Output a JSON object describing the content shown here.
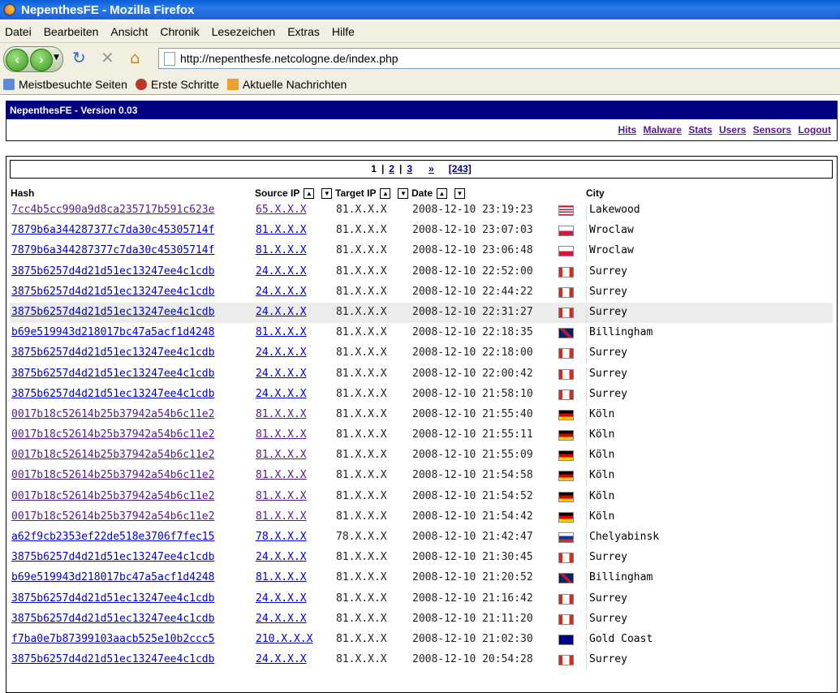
{
  "window": {
    "title": "NepenthesFE - Mozilla Firefox"
  },
  "menu": [
    "Datei",
    "Bearbeiten",
    "Ansicht",
    "Chronik",
    "Lesezeichen",
    "Extras",
    "Hilfe"
  ],
  "address": {
    "url": "http://nepenthesfe.netcologne.de/index.php"
  },
  "bookmarks": [
    "Meistbesuchte Seiten",
    "Erste Schritte",
    "Aktuelle Nachrichten"
  ],
  "app": {
    "title": "NepenthesFE - Version 0.03",
    "nav": [
      "Hits",
      "Malware",
      "Stats",
      "Users",
      "Sensors",
      "Logout"
    ]
  },
  "pager": {
    "current": "1",
    "pages": [
      "2",
      "3"
    ],
    "next": "»",
    "total": "[243]"
  },
  "columns": {
    "hash": "Hash",
    "source_ip": "Source IP",
    "target_ip": "Target IP",
    "date": "Date",
    "city": "City"
  },
  "colors": {
    "flag_us": "#b22234",
    "flag_pl": "#dc143c",
    "flag_ca": "#d52b1e",
    "flag_gb": "#012169",
    "flag_de": "#000000",
    "flag_ru": "#0039a6",
    "flag_au": "#00008b"
  },
  "rows": [
    {
      "hash": "7cc4b5cc990a9d8ca235717b591c623e",
      "src": "65.X.X.X",
      "tgt": "81.X.X.X",
      "date": "2008-12-10 23:19:23",
      "flag": "us",
      "city": "Lakewood",
      "visited": true
    },
    {
      "hash": "7879b6a344287377c7da30c45305714f",
      "src": "81.X.X.X",
      "tgt": "81.X.X.X",
      "date": "2008-12-10 23:07:03",
      "flag": "pl",
      "city": "Wroclaw",
      "visited": false
    },
    {
      "hash": "7879b6a344287377c7da30c45305714f",
      "src": "81.X.X.X",
      "tgt": "81.X.X.X",
      "date": "2008-12-10 23:06:48",
      "flag": "pl",
      "city": "Wroclaw",
      "visited": false
    },
    {
      "hash": "3875b6257d4d21d51ec13247ee4c1cdb",
      "src": "24.X.X.X",
      "tgt": "81.X.X.X",
      "date": "2008-12-10 22:52:00",
      "flag": "ca",
      "city": "Surrey",
      "visited": false
    },
    {
      "hash": "3875b6257d4d21d51ec13247ee4c1cdb",
      "src": "24.X.X.X",
      "tgt": "81.X.X.X",
      "date": "2008-12-10 22:44:22",
      "flag": "ca",
      "city": "Surrey",
      "visited": false
    },
    {
      "hash": "3875b6257d4d21d51ec13247ee4c1cdb",
      "src": "24.X.X.X",
      "tgt": "81.X.X.X",
      "date": "2008-12-10 22:31:27",
      "flag": "ca",
      "city": "Surrey",
      "visited": false,
      "highlight": true
    },
    {
      "hash": "b69e519943d218017bc47a5acf1d4248",
      "src": "81.X.X.X",
      "tgt": "81.X.X.X",
      "date": "2008-12-10 22:18:35",
      "flag": "gb",
      "city": "Billingham",
      "visited": false
    },
    {
      "hash": "3875b6257d4d21d51ec13247ee4c1cdb",
      "src": "24.X.X.X",
      "tgt": "81.X.X.X",
      "date": "2008-12-10 22:18:00",
      "flag": "ca",
      "city": "Surrey",
      "visited": false
    },
    {
      "hash": "3875b6257d4d21d51ec13247ee4c1cdb",
      "src": "24.X.X.X",
      "tgt": "81.X.X.X",
      "date": "2008-12-10 22:00:42",
      "flag": "ca",
      "city": "Surrey",
      "visited": false
    },
    {
      "hash": "3875b6257d4d21d51ec13247ee4c1cdb",
      "src": "24.X.X.X",
      "tgt": "81.X.X.X",
      "date": "2008-12-10 21:58:10",
      "flag": "ca",
      "city": "Surrey",
      "visited": false
    },
    {
      "hash": "0017b18c52614b25b37942a54b6c11e2",
      "src": "81.X.X.X",
      "tgt": "81.X.X.X",
      "date": "2008-12-10 21:55:40",
      "flag": "de",
      "city": "Köln",
      "visited": true
    },
    {
      "hash": "0017b18c52614b25b37942a54b6c11e2",
      "src": "81.X.X.X",
      "tgt": "81.X.X.X",
      "date": "2008-12-10 21:55:11",
      "flag": "de",
      "city": "Köln",
      "visited": true
    },
    {
      "hash": "0017b18c52614b25b37942a54b6c11e2",
      "src": "81.X.X.X",
      "tgt": "81.X.X.X",
      "date": "2008-12-10 21:55:09",
      "flag": "de",
      "city": "Köln",
      "visited": true
    },
    {
      "hash": "0017b18c52614b25b37942a54b6c11e2",
      "src": "81.X.X.X",
      "tgt": "81.X.X.X",
      "date": "2008-12-10 21:54:58",
      "flag": "de",
      "city": "Köln",
      "visited": true
    },
    {
      "hash": "0017b18c52614b25b37942a54b6c11e2",
      "src": "81.X.X.X",
      "tgt": "81.X.X.X",
      "date": "2008-12-10 21:54:52",
      "flag": "de",
      "city": "Köln",
      "visited": true
    },
    {
      "hash": "0017b18c52614b25b37942a54b6c11e2",
      "src": "81.X.X.X",
      "tgt": "81.X.X.X",
      "date": "2008-12-10 21:54:42",
      "flag": "de",
      "city": "Köln",
      "visited": true
    },
    {
      "hash": "a62f9cb2353ef22de518e3706f7fec15",
      "src": "78.X.X.X",
      "tgt": "78.X.X.X",
      "date": "2008-12-10 21:42:47",
      "flag": "ru",
      "city": "Chelyabinsk",
      "visited": false
    },
    {
      "hash": "3875b6257d4d21d51ec13247ee4c1cdb",
      "src": "24.X.X.X",
      "tgt": "81.X.X.X",
      "date": "2008-12-10 21:30:45",
      "flag": "ca",
      "city": "Surrey",
      "visited": false
    },
    {
      "hash": "b69e519943d218017bc47a5acf1d4248",
      "src": "81.X.X.X",
      "tgt": "81.X.X.X",
      "date": "2008-12-10 21:20:52",
      "flag": "gb",
      "city": "Billingham",
      "visited": false
    },
    {
      "hash": "3875b6257d4d21d51ec13247ee4c1cdb",
      "src": "24.X.X.X",
      "tgt": "81.X.X.X",
      "date": "2008-12-10 21:16:42",
      "flag": "ca",
      "city": "Surrey",
      "visited": false
    },
    {
      "hash": "3875b6257d4d21d51ec13247ee4c1cdb",
      "src": "24.X.X.X",
      "tgt": "81.X.X.X",
      "date": "2008-12-10 21:11:20",
      "flag": "ca",
      "city": "Surrey",
      "visited": false
    },
    {
      "hash": "f7ba0e7b87399103aacb525e10b2ccc5",
      "src": "210.X.X.X",
      "tgt": "81.X.X.X",
      "date": "2008-12-10 21:02:30",
      "flag": "au",
      "city": "Gold Coast",
      "visited": false
    },
    {
      "hash": "3875b6257d4d21d51ec13247ee4c1cdb",
      "src": "24.X.X.X",
      "tgt": "81.X.X.X",
      "date": "2008-12-10 20:54:28",
      "flag": "ca",
      "city": "Surrey",
      "visited": false
    }
  ]
}
